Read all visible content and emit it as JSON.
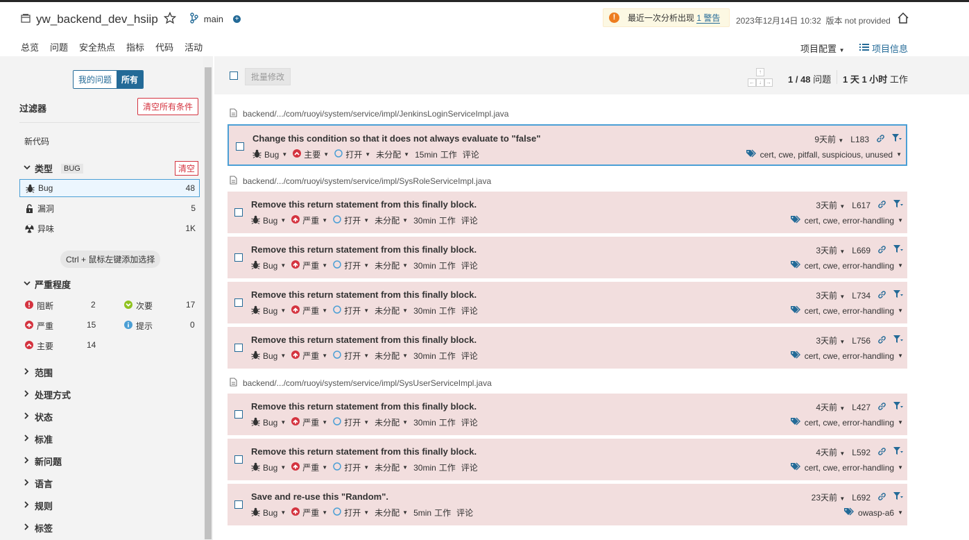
{
  "header": {
    "project_title": "yw_backend_dev_hsiip",
    "branch": "main",
    "warning_text": "最近一次分析出现",
    "warning_link": "1 警告",
    "analysis_date": "2023年12月14日 10:32",
    "version": "版本 not provided",
    "nav": [
      "总览",
      "问题",
      "安全热点",
      "指标",
      "代码",
      "活动"
    ],
    "project_config": "项目配置",
    "project_info": "项目信息"
  },
  "sidebar": {
    "toggle_my": "我的问题",
    "toggle_all": "所有",
    "filters_title": "过滤器",
    "clear_all": "清空所有条件",
    "new_code": "新代码",
    "type_label": "类型",
    "type_tag": "BUG",
    "clear": "清空",
    "types": [
      {
        "label": "Bug",
        "count": "48"
      },
      {
        "label": "漏洞",
        "count": "5"
      },
      {
        "label": "异味",
        "count": "1K"
      }
    ],
    "hint": "Ctrl + 鼠标左键添加选择",
    "severity_label": "严重程度",
    "severities": [
      {
        "label": "阻断",
        "count": "2"
      },
      {
        "label": "次要",
        "count": "17"
      },
      {
        "label": "严重",
        "count": "15"
      },
      {
        "label": "提示",
        "count": "0"
      },
      {
        "label": "主要",
        "count": "14"
      }
    ],
    "facets": [
      "范围",
      "处理方式",
      "状态",
      "标准",
      "新问题",
      "语言",
      "规则",
      "标签"
    ]
  },
  "toolbar": {
    "bulk_change": "批量修改",
    "count_num": "1 / 48",
    "count_unit": "问题",
    "effort_num": "1 天 1 小时",
    "effort_unit": "工作"
  },
  "labels": {
    "open": "打开",
    "unassigned": "未分配",
    "effort_suffix": "工作",
    "comment": "评论"
  },
  "files": [
    "backend/.../com/ruoyi/system/service/impl/JenkinsLoginServiceImpl.java",
    "backend/.../com/ruoyi/system/service/impl/SysRoleServiceImpl.java",
    "backend/.../com/ruoyi/system/service/impl/SysUserServiceImpl.java"
  ],
  "issues": [
    {
      "msg": "Change this condition so that it does not always evaluate to \"false\"",
      "type": "Bug",
      "severity": "主要",
      "effort": "15min",
      "age": "9天前",
      "line": "L183",
      "tags": "cert, cwe, pitfall, suspicious, unused"
    },
    {
      "msg": "Remove this return statement from this finally block.",
      "type": "Bug",
      "severity": "严重",
      "effort": "30min",
      "age": "3天前",
      "line": "L617",
      "tags": "cert, cwe, error-handling"
    },
    {
      "msg": "Remove this return statement from this finally block.",
      "type": "Bug",
      "severity": "严重",
      "effort": "30min",
      "age": "3天前",
      "line": "L669",
      "tags": "cert, cwe, error-handling"
    },
    {
      "msg": "Remove this return statement from this finally block.",
      "type": "Bug",
      "severity": "严重",
      "effort": "30min",
      "age": "3天前",
      "line": "L734",
      "tags": "cert, cwe, error-handling"
    },
    {
      "msg": "Remove this return statement from this finally block.",
      "type": "Bug",
      "severity": "严重",
      "effort": "30min",
      "age": "3天前",
      "line": "L756",
      "tags": "cert, cwe, error-handling"
    },
    {
      "msg": "Remove this return statement from this finally block.",
      "type": "Bug",
      "severity": "严重",
      "effort": "30min",
      "age": "4天前",
      "line": "L427",
      "tags": "cert, cwe, error-handling"
    },
    {
      "msg": "Remove this return statement from this finally block.",
      "type": "Bug",
      "severity": "严重",
      "effort": "30min",
      "age": "4天前",
      "line": "L592",
      "tags": "cert, cwe, error-handling"
    },
    {
      "msg": "Save and re-use this \"Random\".",
      "type": "Bug",
      "severity": "严重",
      "effort": "5min",
      "age": "23天前",
      "line": "L692",
      "tags": "owasp-a6"
    }
  ]
}
